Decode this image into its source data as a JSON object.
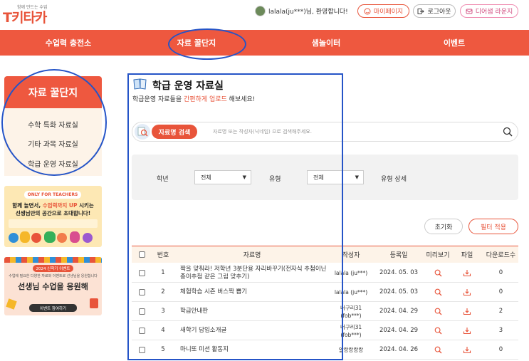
{
  "logo": {
    "sub": "함께 만드는 수업",
    "main": "T키타카"
  },
  "header": {
    "welcome": "lalala(ju***)님, 환영합니다!",
    "mypage": "마이페이지",
    "logout": "로그아웃",
    "lounge": "디어샘 라운지"
  },
  "nav": [
    "수업력 충전소",
    "자료 꿀단지",
    "샘놀이터",
    "이벤트"
  ],
  "sidebar": {
    "title": "자료 꿀단지",
    "items": [
      "수학 특화 자료실",
      "기타 과목 자료실",
      "학급 운영 자료실"
    ]
  },
  "banner1": {
    "tag": "ONLY FOR TEACHERS",
    "line1": "함께 놀면서, ",
    "line1_hl": "수업력까지 UP",
    "line1_end": " 시키는",
    "line2": "선생님만의 공간으로 초대합니다!"
  },
  "banner2": {
    "tag": "2024 신학기 이벤트",
    "desc": "수업에 필요한 다양한 자료와 이벤트로 선생님을 응원합니다",
    "headline": "선생님 수업을 응원해",
    "button": "이벤트 참여하기"
  },
  "main": {
    "title": "학급 운영 자료실",
    "subtitle_pre": "학급운영 자료들을 ",
    "subtitle_hl": "간편하게 업로드",
    "subtitle_post": " 해보세요!",
    "search_label": "자료명 검색",
    "search_placeholder": "자료명 또는 작성자(닉네임) 으로 검색해주세요.",
    "filters": {
      "grade_label": "학년",
      "grade_value": "전체",
      "type_label": "유형",
      "type_value": "전체",
      "type_detail_label": "유형 상세"
    },
    "reset": "초기화",
    "apply": "필터 적용"
  },
  "table": {
    "headers": [
      "번호",
      "자료명",
      "작성자",
      "등록일",
      "미리보기",
      "파일",
      "다운로드수"
    ],
    "rows": [
      {
        "no": "1",
        "title": "짝을 맞춰라! 저학년 3분단용 자리바꾸기(전자식 추첨이닌 종이추첨 같은 그림 맞추기)",
        "author": "lalala (ju***)",
        "date": "2024. 05. 03",
        "downloads": "0"
      },
      {
        "no": "2",
        "title": "체험학습 시즌 버스짝 뽑기",
        "author": "lalala (ju***)",
        "date": "2024. 05. 03",
        "downloads": "0"
      },
      {
        "no": "3",
        "title": "학급안내판",
        "author": "너구리31 (fob***)",
        "date": "2024. 04. 29",
        "downloads": "2"
      },
      {
        "no": "4",
        "title": "새학기 담임소개글",
        "author": "너구리31 (fob***)",
        "date": "2024. 04. 29",
        "downloads": "3"
      },
      {
        "no": "5",
        "title": "마니또 미션 활동지",
        "author": "알랑랑랑랑",
        "date": "2024. 04. 26",
        "downloads": "0"
      }
    ]
  },
  "colors": {
    "accent": "#ee583f",
    "annotation": "#2554c7",
    "sidebar_bg": "#fdf3e8"
  },
  "icons": [
    "user-avatar-icon",
    "smile-icon",
    "logout-icon",
    "lounge-icon",
    "book-icon",
    "search-icon",
    "magnifier-icon",
    "download-icon",
    "dropdown-arrow-icon"
  ]
}
